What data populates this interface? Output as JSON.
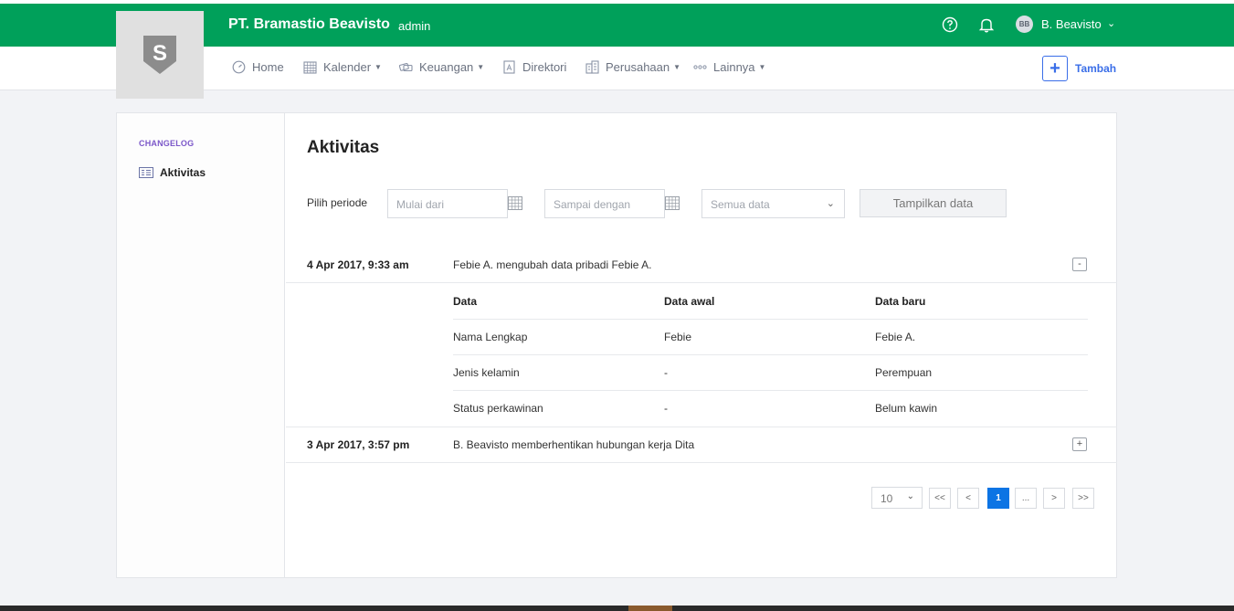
{
  "header": {
    "company": "PT. Bramastio Beavisto",
    "role": "admin",
    "user_initials": "BB",
    "user_name": "B. Beavisto",
    "brand_color": "#00a05a",
    "logo_letter": "S"
  },
  "nav": {
    "items": [
      {
        "label": "Home",
        "icon": "dashboard-icon"
      },
      {
        "label": "Kalender",
        "icon": "calendar-icon"
      },
      {
        "label": "Keuangan",
        "icon": "money-icon"
      },
      {
        "label": "Direktori",
        "icon": "directory-icon"
      },
      {
        "label": "Perusahaan",
        "icon": "building-icon"
      },
      {
        "label": "Lainnya",
        "icon": "more-icon"
      }
    ],
    "add_label": "Tambah"
  },
  "sidebar": {
    "heading": "CHANGELOG",
    "item": "Aktivitas"
  },
  "main": {
    "title": "Aktivitas",
    "filter": {
      "label": "Pilih periode",
      "start_placeholder": "Mulai dari",
      "end_placeholder": "Sampai dengan",
      "select_value": "Semua data",
      "show_button": "Tampilkan data"
    },
    "logs": [
      {
        "date": "4 Apr 2017, 9:33 am",
        "description": "Febie A. mengubah data pribadi Febie A.",
        "toggle": "-",
        "details": {
          "headers": [
            "Data",
            "Data awal",
            "Data baru"
          ],
          "rows": [
            [
              "Nama Lengkap",
              "Febie",
              "Febie A."
            ],
            [
              "Jenis kelamin",
              "-",
              "Perempuan"
            ],
            [
              "Status perkawinan",
              "-",
              "Belum kawin"
            ]
          ]
        }
      },
      {
        "date": "3 Apr 2017, 3:57 pm",
        "description": "B. Beavisto memberhentikan hubungan kerja Dita",
        "toggle": "+"
      }
    ],
    "pagination": {
      "per_page": "10",
      "first": "<<",
      "prev": "<",
      "current": "1",
      "ellipsis": "...",
      "next": ">",
      "last": ">>"
    }
  }
}
